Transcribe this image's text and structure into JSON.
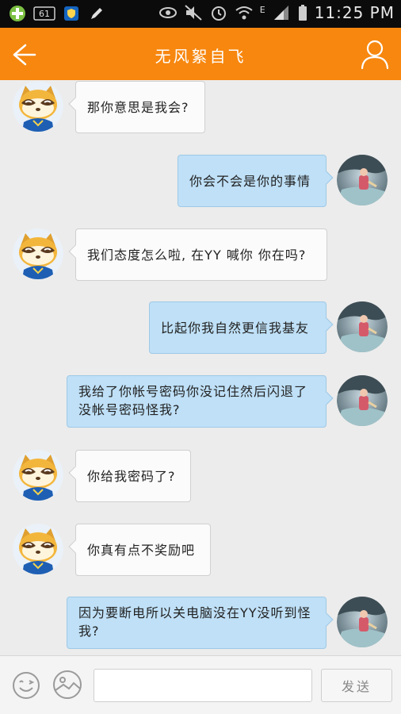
{
  "status_bar": {
    "time": "11:25 PM",
    "network_label": "E",
    "icons": [
      "add-circle-icon",
      "notification-61-icon",
      "shield-icon",
      "pen-icon",
      "eye-icon",
      "mute-icon",
      "alarm-icon",
      "wifi-icon",
      "signal-icon",
      "battery-icon"
    ],
    "badge_text": "61"
  },
  "header": {
    "title": "无风絮自飞",
    "back_icon": "back-arrow-icon",
    "profile_icon": "person-icon"
  },
  "messages": [
    {
      "side": "in",
      "avatar": "raccoon-avatar",
      "text": "那你意思是我会?"
    },
    {
      "side": "out",
      "avatar": "user-photo-avatar",
      "text": "你会不会是你的事情"
    },
    {
      "side": "in",
      "avatar": "raccoon-avatar",
      "text": "我们态度怎么啦, 在YY 喊你 你在吗?"
    },
    {
      "side": "out",
      "avatar": "user-photo-avatar",
      "text": "比起你我自然更信我基友"
    },
    {
      "side": "out",
      "avatar": "user-photo-avatar",
      "text": "我给了你帐号密码你没记住然后闪退了没帐号密码怪我?"
    },
    {
      "side": "in",
      "avatar": "raccoon-avatar",
      "text": "你给我密码了?"
    },
    {
      "side": "in",
      "avatar": "raccoon-avatar",
      "text": "你真有点不奖励吧"
    },
    {
      "side": "out",
      "avatar": "user-photo-avatar",
      "text": "因为要断电所以关电脑没在YY没听到怪我?"
    }
  ],
  "input_bar": {
    "placeholder": "",
    "send_label": "发送",
    "emoji_icon": "smiley-icon",
    "image_icon": "image-icon"
  },
  "colors": {
    "accent": "#f7870f",
    "incoming_bubble": "#fbfbfb",
    "outgoing_bubble": "#bfe0f7",
    "background": "#ececec"
  }
}
